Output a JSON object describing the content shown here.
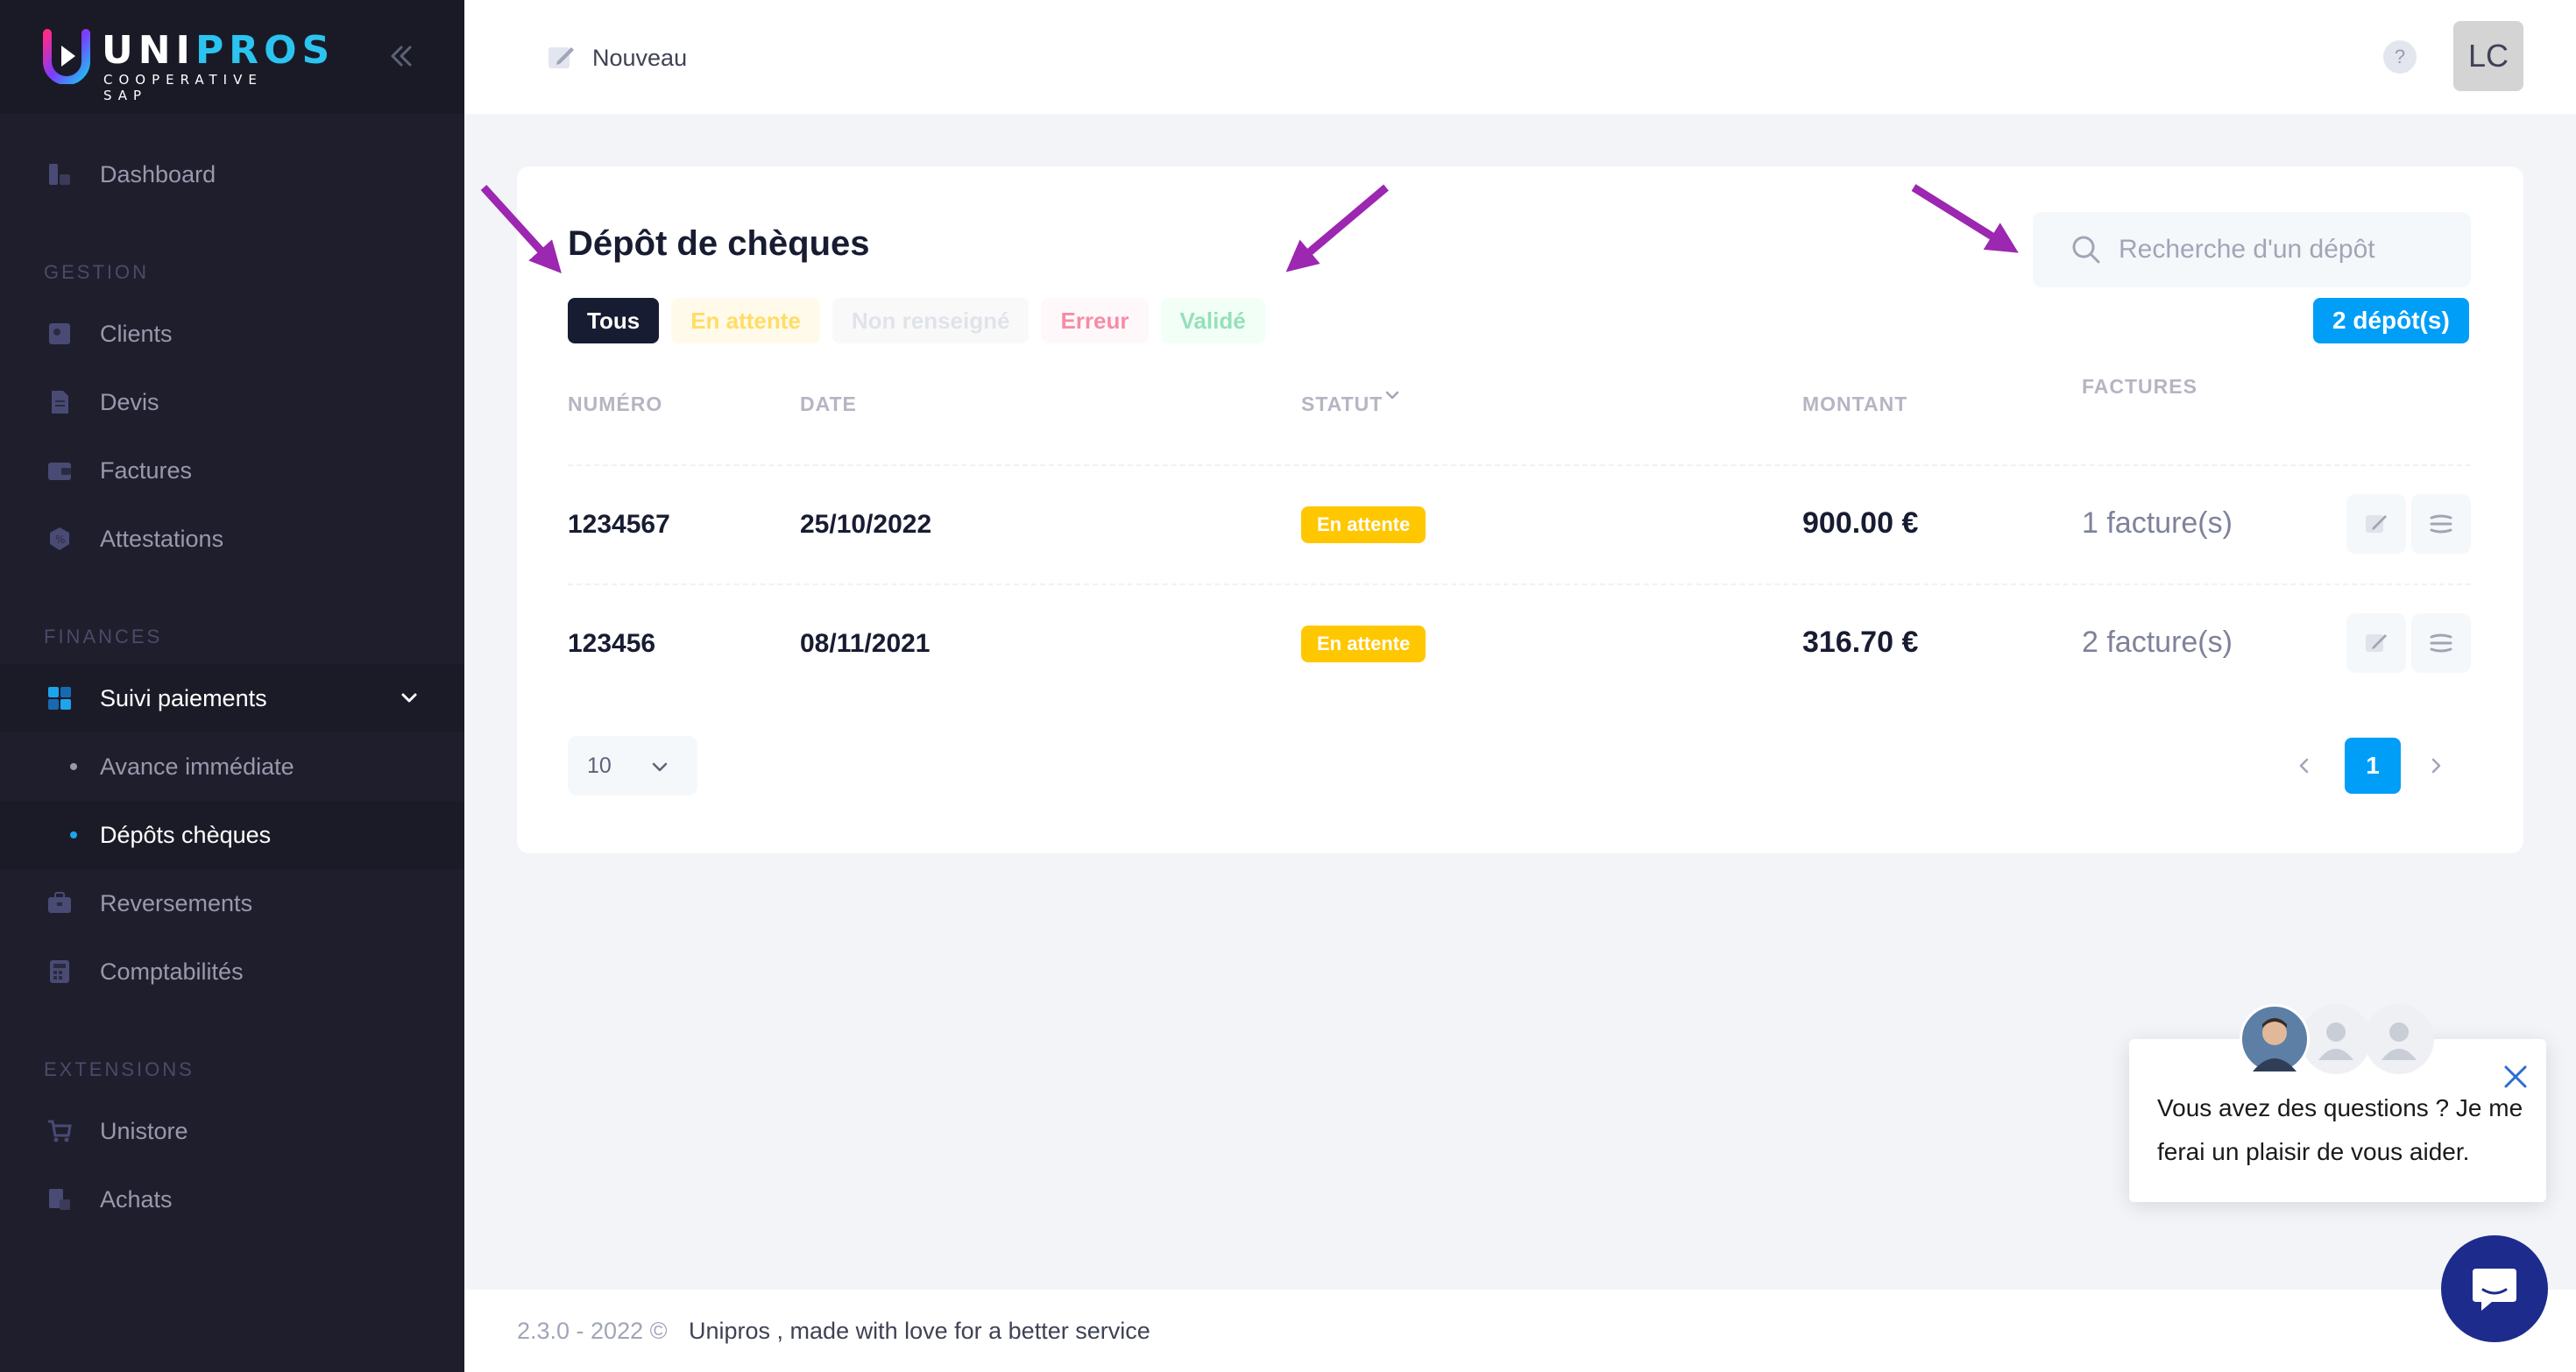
{
  "brand": {
    "name_part1": "UNI",
    "name_part2": "PROS",
    "tagline": "COOPERATIVE SAP"
  },
  "sidebar": {
    "sections": {
      "gestion": "GESTION",
      "finances": "FINANCES",
      "extensions": "EXTENSIONS"
    },
    "items": {
      "dashboard": "Dashboard",
      "clients": "Clients",
      "devis": "Devis",
      "factures": "Factures",
      "attestations": "Attestations",
      "suivi": "Suivi paiements",
      "avance": "Avance immédiate",
      "depots": "Dépôts chèques",
      "reversements": "Reversements",
      "comptabilites": "Comptabilités",
      "unistore": "Unistore",
      "achats": "Achats"
    }
  },
  "header": {
    "new_label": "Nouveau",
    "help": "?",
    "avatar": "LC"
  },
  "card": {
    "title": "Dépôt de chèques",
    "filters": {
      "all": "Tous",
      "waiting": "En attente",
      "none": "Non renseigné",
      "error": "Erreur",
      "validated": "Validé"
    },
    "search_placeholder": "Recherche d'un dépôt",
    "count": "2 dépôt(s)",
    "columns": {
      "numero": "NUMÉRO",
      "date": "DATE",
      "statut": "STATUT",
      "montant": "MONTANT",
      "factures": "FACTURES"
    },
    "rows": [
      {
        "numero": "1234567",
        "date": "25/10/2022",
        "statut": "En attente",
        "montant": "900.00 €",
        "factures": "1 facture(s)"
      },
      {
        "numero": "123456",
        "date": "08/11/2021",
        "statut": "En attente",
        "montant": "316.70 €",
        "factures": "2 facture(s)"
      }
    ],
    "per_page": "10",
    "current_page": "1"
  },
  "footer": {
    "version": "2.3.0 - 2022 ©",
    "credit": "Unipros , made with love for a better service"
  },
  "chat": {
    "message": "Vous avez des questions ? Je me ferai un plaisir de vous aider."
  },
  "colors": {
    "sidebar": "#1e1e2d",
    "primary": "#009ef7",
    "warning": "#ffc700",
    "annotation": "#9c27b0"
  }
}
